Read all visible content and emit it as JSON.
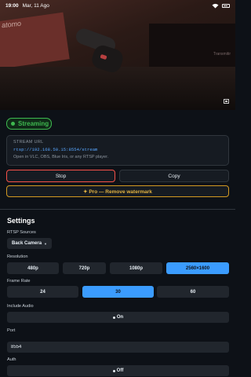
{
  "status_bar": {
    "time": "19:00",
    "date": "Mar, 11 Ago"
  },
  "preview": {
    "background_text": "atomo",
    "box_text": "Transmitir"
  },
  "streaming_badge": {
    "label": "Streaming",
    "color": "#3fb950"
  },
  "stream_url_card": {
    "label": "STREAM URL",
    "url": "rtsp://192.168.50.15:8554/stream",
    "hint": "Open in VLC, OBS, Blue Iris, or any RTSP player."
  },
  "actions": {
    "stop_label": "Stop",
    "copy_label": "Copy",
    "pro_label": "✦ Pro — Remove watermark"
  },
  "settings": {
    "title": "Settings",
    "rtsp_sources": {
      "label": "RTSP Sources",
      "selected": "Back Camera"
    },
    "resolution": {
      "label": "Resolution",
      "options": [
        "480p",
        "720p",
        "1080p",
        "2560×1600"
      ],
      "selected": "2560×1600"
    },
    "frame_rate": {
      "label": "Frame Rate",
      "options": [
        "24",
        "30",
        "60"
      ],
      "selected": "30"
    },
    "include_audio": {
      "label": "Include Audio",
      "value": "On"
    },
    "port": {
      "label": "Port",
      "value": "8554"
    },
    "auth": {
      "label": "Auth",
      "value": "Off"
    }
  },
  "colors": {
    "accent": "#3b9cff",
    "danger": "#f85149",
    "pro": "#d29922",
    "background": "#0d1117"
  }
}
